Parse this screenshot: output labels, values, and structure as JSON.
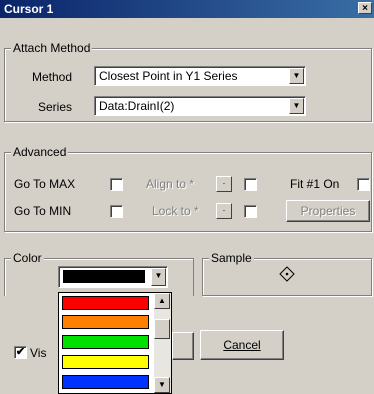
{
  "window": {
    "title": "Cursor 1",
    "close_glyph": "×"
  },
  "attach": {
    "legend": "Attach Method",
    "method_label": "Method",
    "method_value": "Closest Point in Y1 Series",
    "series_label": "Series",
    "series_value": "Data:DrainI(2)"
  },
  "advanced": {
    "legend": "Advanced",
    "goto_max": "Go To MAX",
    "goto_min": "Go To MIN",
    "align_to": "Align to *",
    "lock_to": "Lock to *",
    "fit_on": "Fit #1 On",
    "properties": "Properties"
  },
  "color": {
    "legend": "Color",
    "selected": "#000000",
    "options": [
      "#ff0000",
      "#ff8000",
      "#00e000",
      "#ffff00",
      "#0033ff"
    ]
  },
  "sample": {
    "legend": "Sample"
  },
  "bottom": {
    "visible_label": "Vis",
    "visible_checked": "✔",
    "cancel": "Cancel"
  },
  "icons": {
    "dropdown": "chevron-down-icon",
    "scroll_up": "arrow-up-icon",
    "scroll_down": "arrow-down-icon",
    "marker": "diamond-marker-icon"
  }
}
